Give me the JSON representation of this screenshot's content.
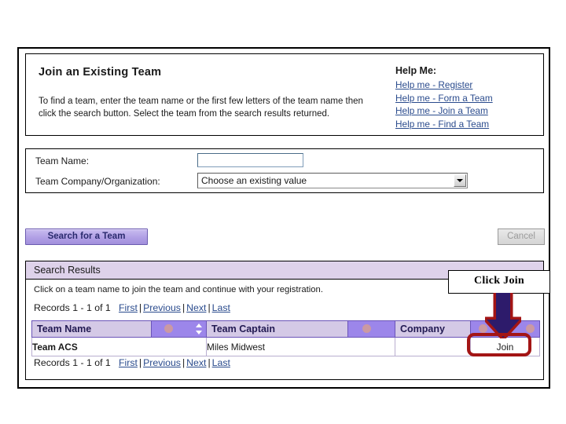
{
  "intro": {
    "title": "Join an Existing Team",
    "body": "To find a team, enter the team name or the first few letters of the team name then click the search button. Select the team from the search results returned."
  },
  "help": {
    "title": "Help Me:",
    "links": [
      "Help me - Register",
      "Help me - Form a Team",
      "Help me - Join a Team",
      "Help me - Find a Team"
    ]
  },
  "form": {
    "team_name_label": "Team Name:",
    "team_name_value": "",
    "team_name_placeholder": "",
    "org_label": "Team Company/Organization:",
    "org_selected": "Choose an existing value",
    "org_options": [
      "Choose an existing value"
    ]
  },
  "buttons": {
    "search_label": "Search for a Team",
    "cancel_label": "Cancel"
  },
  "results": {
    "header": "Search Results",
    "instruction": "Click on a team name to join the team and continue with your registration.",
    "pager": {
      "records": "Records 1 - 1 of 1",
      "first": "First",
      "previous": "Previous",
      "next": "Next",
      "last": "Last",
      "separator": "|"
    },
    "columns": [
      "Team Name",
      "Team Captain",
      "Company"
    ],
    "rows": [
      {
        "team_name": "Team ACS",
        "team_captain": "Miles Midwest",
        "company": "",
        "action": "Join"
      }
    ]
  },
  "annotation": {
    "callout_text": "Click Join",
    "highlight_color": "#a31515",
    "arrow_fill": "#2d1b6b",
    "arrow_outline": "#a31515"
  },
  "colors": {
    "button_purple": "#a18fdc",
    "header_light": "#d4c9e6",
    "header_mid": "#9c86ea",
    "results_bar": "#ded2ea",
    "link_blue": "#2a4b8d",
    "team_link_purple": "#4b2d7f"
  }
}
